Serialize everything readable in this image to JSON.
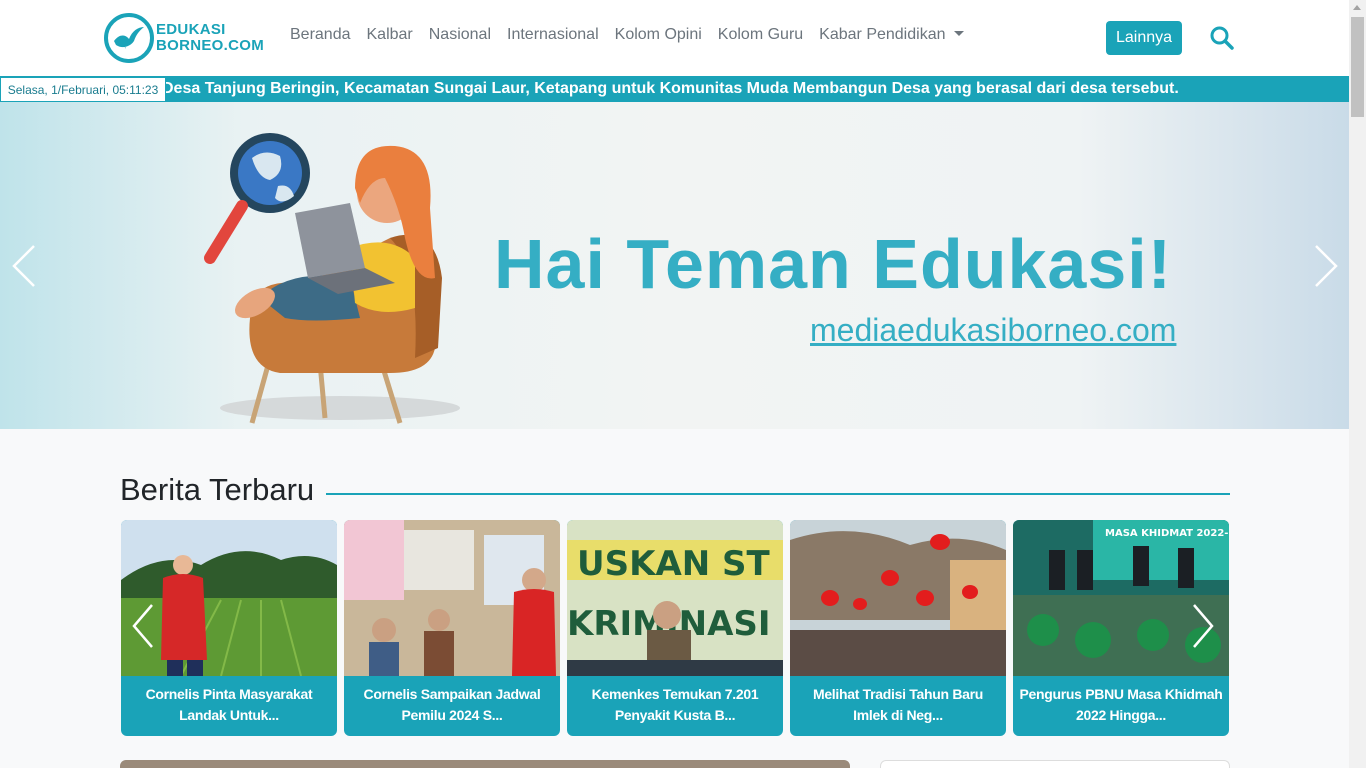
{
  "brand": {
    "line1": "EDUKASI",
    "line2": "BORNEO.COM",
    "accent_color": "#1aa3b8"
  },
  "nav": {
    "items": [
      {
        "label": "Beranda"
      },
      {
        "label": "Kalbar"
      },
      {
        "label": "Nasional"
      },
      {
        "label": "Internasional"
      },
      {
        "label": "Kolom Opini"
      },
      {
        "label": "Kolom Guru"
      },
      {
        "label": "Kabar Pendidikan"
      }
    ],
    "more_button": "Lainnya",
    "search_icon": "search-icon"
  },
  "ticker": {
    "date": "Selasa, 1/Februari, 05:11:23",
    "text": "Desa Tanjung Beringin, Kecamatan Sungai Laur, Ketapang untuk Komunitas Muda Membangun Desa yang berasal dari desa tersebut."
  },
  "hero": {
    "title": "Hai Teman Edukasi!",
    "url": "mediaedukasiborneo.com"
  },
  "latest": {
    "title": "Berita Terbaru",
    "cards": [
      {
        "title": "Cornelis Pinta Masyarakat Landak Untuk..."
      },
      {
        "title": "Cornelis Sampaikan Jadwal Pemilu 2024 S..."
      },
      {
        "title": "Kemenkes Temukan 7.201 Penyakit Kusta B..."
      },
      {
        "title": "Melihat Tradisi Tahun Baru Imlek di Neg..."
      },
      {
        "title": "Pengurus PBNU Masa Khidmah 2022 Hingga..."
      }
    ]
  }
}
